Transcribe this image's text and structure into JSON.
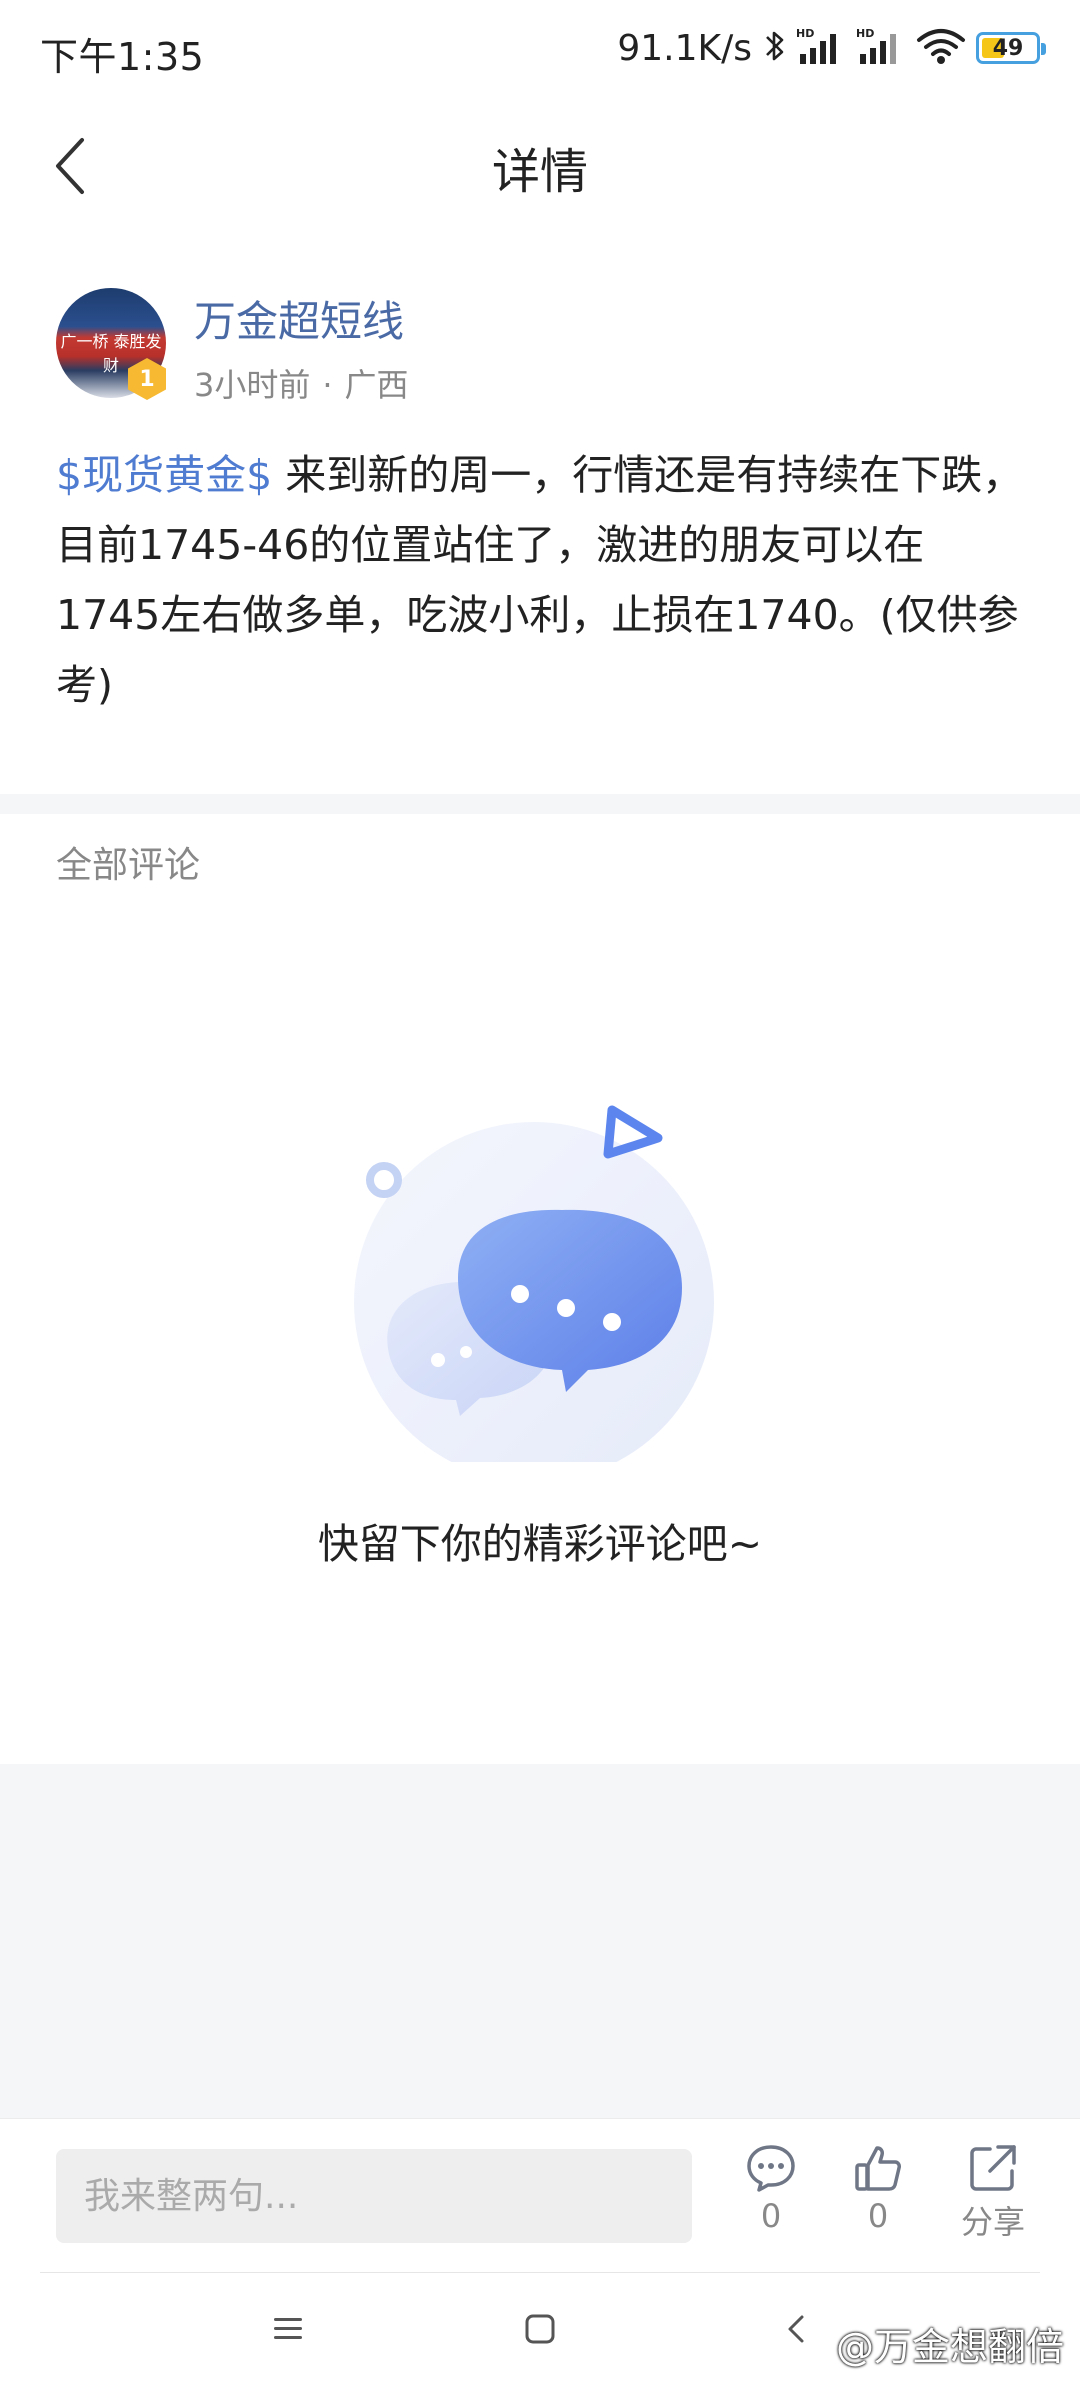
{
  "status_bar": {
    "time": "下午1:35",
    "net_speed": "91.1K/s",
    "battery": "49",
    "battery_level": 0.49,
    "icons": [
      "bluetooth-icon",
      "signal-hd-icon",
      "signal-hd-icon",
      "wifi-icon",
      "battery-icon"
    ]
  },
  "header": {
    "title": "详情",
    "back_icon": "chevron-left-icon"
  },
  "post": {
    "author": "万金超短线",
    "avatar_text": "广一桥 泰胜发财",
    "level_badge": "1",
    "time": "3小时前",
    "location": "广西",
    "tag": "$现货黄金$",
    "content": "来到新的周一，行情还是有持续在下跌，目前1745-46的位置站住了，激进的朋友可以在1745左右做多单，吃波小利，止损在1740。(仅供参考)"
  },
  "comments": {
    "title": "全部评论",
    "empty_text": "快留下你的精彩评论吧~"
  },
  "bottom_bar": {
    "input_placeholder": "我来整两句...",
    "comment_count": "0",
    "like_count": "0",
    "share_label": "分享"
  },
  "watermark": "@万金想翻倍",
  "colors": {
    "accent": "#4f7bd1",
    "username": "#4a6aa6",
    "badge": "#f6b931",
    "background": "#f5f6f8"
  }
}
